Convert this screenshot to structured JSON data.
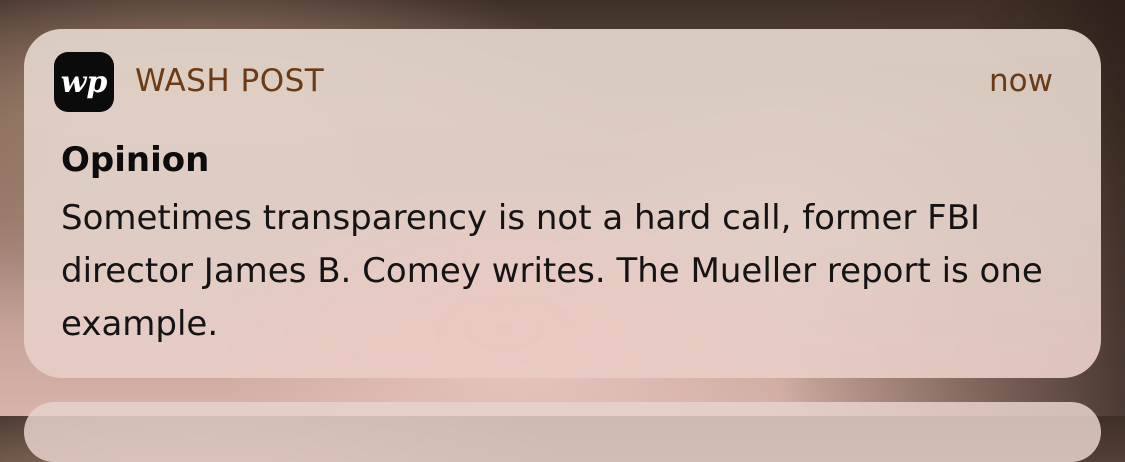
{
  "notification": {
    "app_icon": "washington-post-logo-icon",
    "app_icon_text": "wp",
    "app_name": "WASH POST",
    "timestamp": "now",
    "title": "Opinion",
    "body": "Sometimes transparency is not a hard call, former FBI director James B. Comey writes. The Mueller report is one example."
  },
  "colors": {
    "app_name": "#6b3a16",
    "title": "#0c0c0c",
    "icon_bg": "#0b0b0b"
  }
}
